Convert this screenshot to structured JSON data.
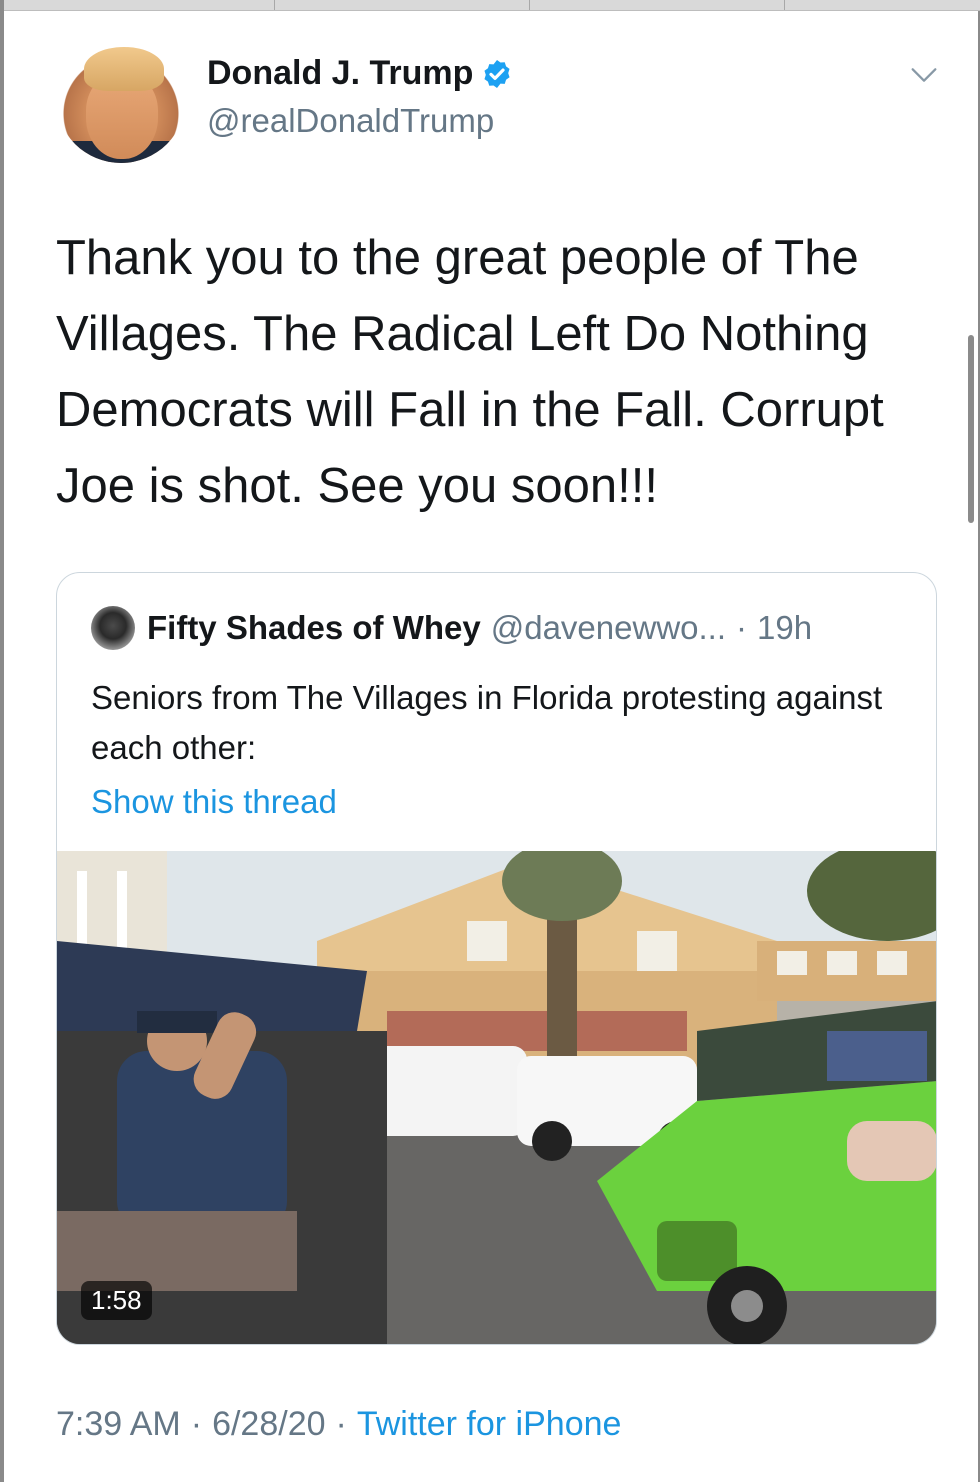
{
  "author": {
    "name": "Donald J. Trump",
    "handle": "@realDonaldTrump",
    "verified_icon": "verified-badge-icon"
  },
  "tweet": {
    "text": "Thank you to the great people of The Villages. The Radical Left Do Nothing Democrats will Fall in the Fall. Corrupt Joe is shot. See you soon!!!"
  },
  "quoted": {
    "name": "Fifty Shades of Whey",
    "handle": "@davenewwo...",
    "separator": "·",
    "time": "19h",
    "text": "Seniors from The Villages in Florida protesting against each other:",
    "thread_link": "Show this thread",
    "video_duration": "1:58"
  },
  "footer": {
    "time": "7:39 AM",
    "sep1": "·",
    "date": "6/28/20",
    "sep2": "·",
    "source": "Twitter for iPhone"
  },
  "colors": {
    "text": "#14171a",
    "secondary": "#657786",
    "link": "#1b95e0",
    "verified": "#1da1f2",
    "border": "#ccd6dd"
  }
}
